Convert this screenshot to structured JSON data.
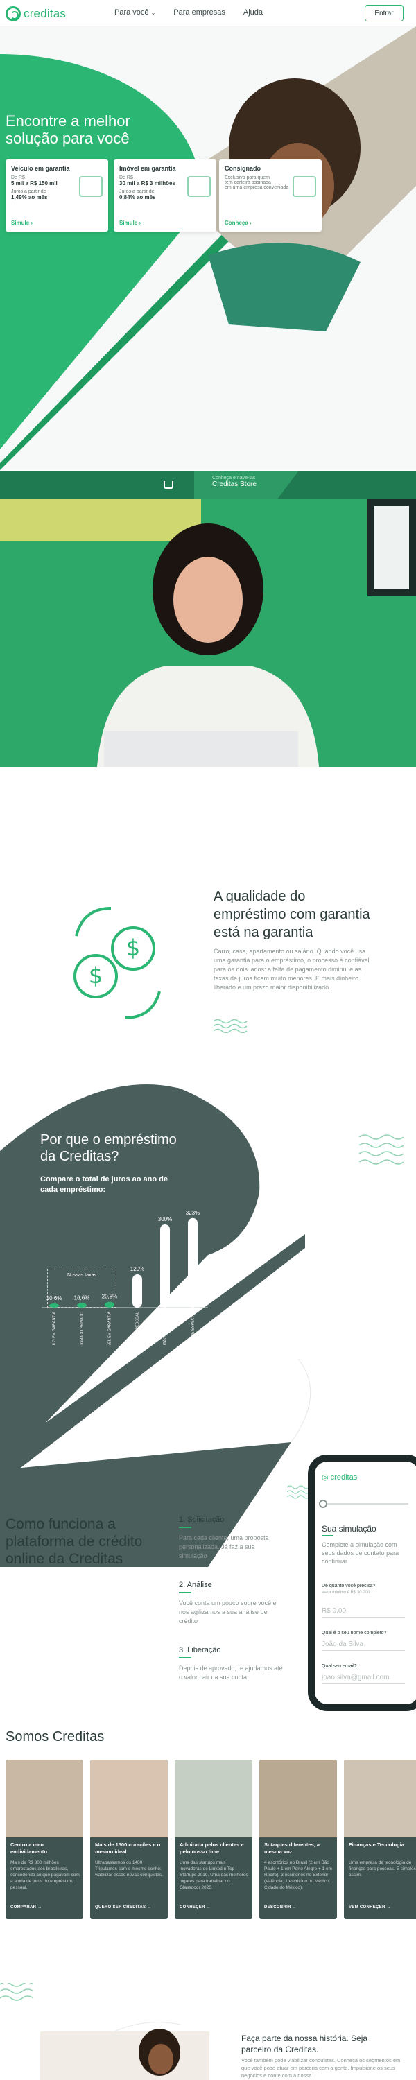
{
  "header": {
    "logo_text": "creditas",
    "nav": [
      "Para você",
      "Para empresas",
      "Ajuda"
    ],
    "enter_label": "Entrar"
  },
  "hero": {
    "title": "Encontre a melhor solução para você",
    "cards": [
      {
        "title": "Veículo em garantia",
        "line1": "De R$",
        "line2": "5 mil a R$ 150 mil",
        "line3": "Juros a partir de",
        "rate": "1,49% ao mês",
        "link": "Simule"
      },
      {
        "title": "Imóvel em garantia",
        "line1": "De R$",
        "line2": "30 mil a R$ 3 milhões",
        "line3": "Juros a partir de",
        "rate": "0,84% ao mês",
        "link": "Simule"
      },
      {
        "title": "Consignado",
        "line1": "Exclusivo para quem",
        "line2": "tem carteira assinada",
        "line3": "em uma empresa conveniada",
        "rate": "",
        "link": "Conheça"
      }
    ]
  },
  "store": {
    "subtitle": "Conheça e nave-ias",
    "title": "Creditas Store"
  },
  "quality": {
    "title": "A qualidade do empréstimo com garantia está na garantia",
    "text": "Carro, casa, apartamento ou salário. Quando você usa uma garantia para o empréstimo, o processo é confiável para os dois lados: a falta de pagamento diminui e as taxas de juros ficam muito menores. E mais dinheiro liberado e um prazo maior disponibilizado."
  },
  "why": {
    "title": "Por que o empréstimo da Creditas?",
    "subtitle": "Compare o total de juros ao ano de cada empréstimo:",
    "group_label": "Nossas taxas"
  },
  "chart_data": {
    "type": "bar",
    "title": "",
    "categories": [
      "VEÍCULO EM GARANTIA",
      "CONSIGNADO PRIVADO",
      "IMÓVEL EM GARANTIA",
      "EMPRÉSTIMO PESSOAL",
      "CARTÃO DE CRÉDITO",
      "CHEQUE ESPECIAL"
    ],
    "values": [
      10.6,
      16.6,
      20.8,
      120,
      300,
      323
    ],
    "value_labels": [
      "10,6%",
      "16,6%",
      "20,8%",
      "120%",
      "300%",
      "323%"
    ],
    "ylim": [
      0,
      340
    ],
    "grid": false,
    "colors": {
      "ours": "#2bb673",
      "others": "#ffffff"
    }
  },
  "how": {
    "title": "Como funciona a plataforma de crédito online da Creditas",
    "steps": [
      {
        "title": "1. Solicitação",
        "text": "Para cada cliente, uma proposta personalizada. Já faz a sua simulação"
      },
      {
        "title": "2. Análise",
        "text": "Você conta um pouco sobre você e nós agilizamos a sua análise de crédito"
      },
      {
        "title": "3. Liberação",
        "text": "Depois de aprovado, te ajudamos até o valor cair na sua conta"
      }
    ]
  },
  "phone": {
    "logo": "creditas",
    "title": "Sua simulação",
    "text": "Complete a simulação com seus dados de contato para continuar.",
    "q1": "De quanto você precisa?",
    "q1_hint": "Valor mínimo é R$ 30.000",
    "q1_value": "R$ 0,00",
    "q2": "Qual é o seu nome completo?",
    "q2_value": "João da Silva",
    "q3": "Qual seu email?",
    "q3_value": "joao.silva@gmail.com"
  },
  "somos": {
    "title": "Somos Creditas",
    "cards": [
      {
        "title": "Centro a meu endividamento",
        "text": "Mais de R$ 800 milhões emprestados aos brasileiros, concedendo ao que pagavam com a ajuda de juros do empréstimo pessoal.",
        "link": "COMPARAR"
      },
      {
        "title": "Mais de 1500 corações e o mesmo ideal",
        "text": "Ultrapassamos os 1400 Tripulantes com o mesmo sonho: viabilizar essas novas conquistas.",
        "link": "QUERO SER CREDITAS"
      },
      {
        "title": "Admirada pelos clientes e pelo nosso time",
        "text": "Uma das startups mais inovadoras de LinkedIn Top Startups 2019. Uma das melhores lugares para trabalhar no Glassdoor 2020.",
        "link": "CONHEÇER"
      },
      {
        "title": "Sotaques diferentes, a mesma voz",
        "text": "4 escritórios no Brasil (2 em São Paulo + 1 em Porto Alegre + 1 em Recife), 3 escritórios no Exterior (Valência, 1 escritório no México: Cidade do México).",
        "link": "DESCOBRIR"
      },
      {
        "title": "Finanças e Tecnologia",
        "text": "Uma empresa de tecnologia de finanças para pessoas. É simples assim.",
        "link": "VEM CONHEÇER"
      }
    ]
  },
  "partner": {
    "title": "Faça parte da nossa história. Seja parceiro da Creditas.",
    "text": "Você também pode viabilizar conquistas. Conheça os segmentos em que você pode atuar em parceria com a gente. Impulsione os seus negócios e conte com a nossa"
  }
}
